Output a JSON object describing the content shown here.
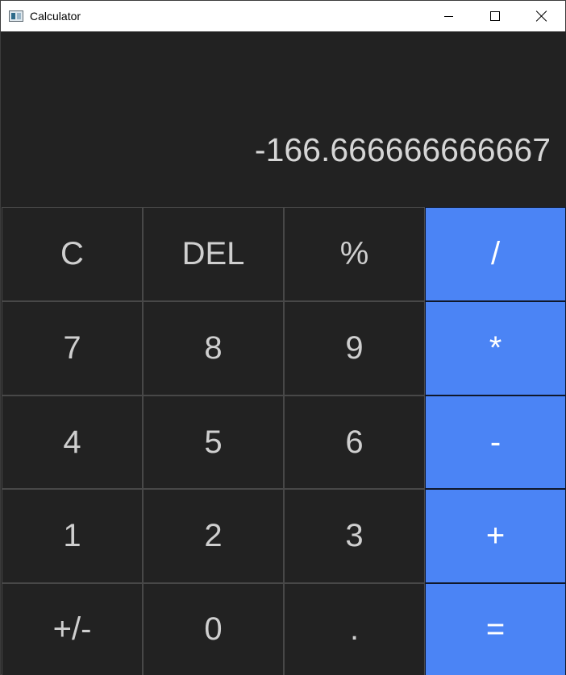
{
  "window": {
    "title": "Calculator",
    "controls": [
      "minimize",
      "maximize",
      "close"
    ]
  },
  "display": {
    "value": "-166.666666666667"
  },
  "keypad": {
    "keys": [
      {
        "label": "C",
        "type": "function"
      },
      {
        "label": "DEL",
        "type": "function"
      },
      {
        "label": "%",
        "type": "function"
      },
      {
        "label": "/",
        "type": "operator"
      },
      {
        "label": "7",
        "type": "digit"
      },
      {
        "label": "8",
        "type": "digit"
      },
      {
        "label": "9",
        "type": "digit"
      },
      {
        "label": "*",
        "type": "operator"
      },
      {
        "label": "4",
        "type": "digit"
      },
      {
        "label": "5",
        "type": "digit"
      },
      {
        "label": "6",
        "type": "digit"
      },
      {
        "label": "-",
        "type": "operator"
      },
      {
        "label": "1",
        "type": "digit"
      },
      {
        "label": "2",
        "type": "digit"
      },
      {
        "label": "3",
        "type": "digit"
      },
      {
        "label": "+",
        "type": "operator"
      },
      {
        "label": "+/-",
        "type": "function"
      },
      {
        "label": "0",
        "type": "digit"
      },
      {
        "label": ".",
        "type": "digit"
      },
      {
        "label": "=",
        "type": "operator"
      }
    ]
  },
  "colors": {
    "background": "#222222",
    "operator_key": "#4b84f5",
    "text": "#d6d6d6"
  }
}
